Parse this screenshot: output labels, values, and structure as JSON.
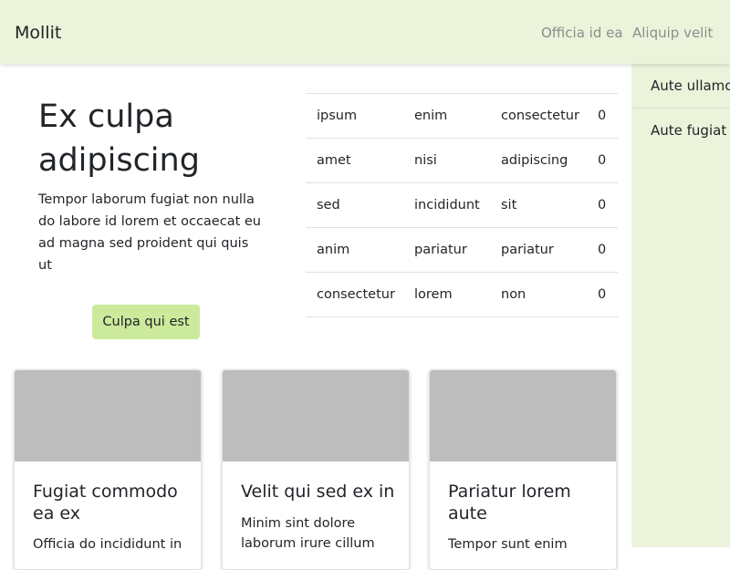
{
  "navbar": {
    "brand": "Mollit",
    "links": [
      "Officia id ea",
      "Aliquip velit"
    ],
    "background": "#ebf4db"
  },
  "sidebar": {
    "items": [
      "Aute ullamco",
      "Aute fugiat"
    ]
  },
  "hero": {
    "title": "Ex culpa adipiscing",
    "text": "Tempor laborum fugiat non nulla do labore id lorem et occaecat eu ad magna sed proident qui quis ut",
    "button_label": "Culpa qui est",
    "button_color": "#ccea9c"
  },
  "table": {
    "rows": [
      [
        "ipsum",
        "enim",
        "consectetur",
        "0"
      ],
      [
        "amet",
        "nisi",
        "adipiscing",
        "0"
      ],
      [
        "sed",
        "incididunt",
        "sit",
        "0"
      ],
      [
        "anim",
        "pariatur",
        "pariatur",
        "0"
      ],
      [
        "consectetur",
        "lorem",
        "non",
        "0"
      ]
    ]
  },
  "cards": [
    {
      "title": "Fugiat commodo ea ex",
      "text": "Officia do incididunt in"
    },
    {
      "title": "Velit qui sed ex in",
      "text": "Minim sint dolore laborum irure cillum"
    },
    {
      "title": "Pariatur lorem aute",
      "text": "Tempor sunt enim"
    }
  ]
}
